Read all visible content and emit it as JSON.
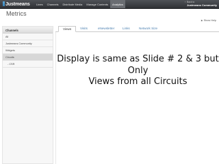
{
  "topnav": {
    "logo": "Justmeans",
    "items": [
      {
        "label": "Lines"
      },
      {
        "label": "Channels"
      },
      {
        "label": "Distribute Media"
      },
      {
        "label": "Manage Contents"
      },
      {
        "label": "Analytics"
      }
    ],
    "active_index": 4,
    "back_small": "Back to",
    "back_link": "Justmeans Community"
  },
  "page": {
    "title": "Metrics",
    "help_label": "Show Help"
  },
  "sidebar": {
    "header": "Channels",
    "items": [
      {
        "label": "All"
      },
      {
        "label": "Justmeans Community"
      },
      {
        "label": "Widgets"
      },
      {
        "label": "Circuits"
      },
      {
        "label": "- CSR"
      }
    ],
    "selected_index": 3
  },
  "tabs": [
    {
      "label": "Views"
    },
    {
      "label": "Visits"
    },
    {
      "label": "eNewsletter"
    },
    {
      "label": "Links"
    },
    {
      "label": "Network Size"
    }
  ],
  "note": {
    "line1": "Display is same as Slide # 2 & 3 but",
    "line2": "Only",
    "line3": "Views from all Circuits"
  },
  "colors": {
    "topbar": "#3a3c40",
    "tab_link": "#4a7fb0",
    "sidebar_selected": "#d7d7d7"
  }
}
